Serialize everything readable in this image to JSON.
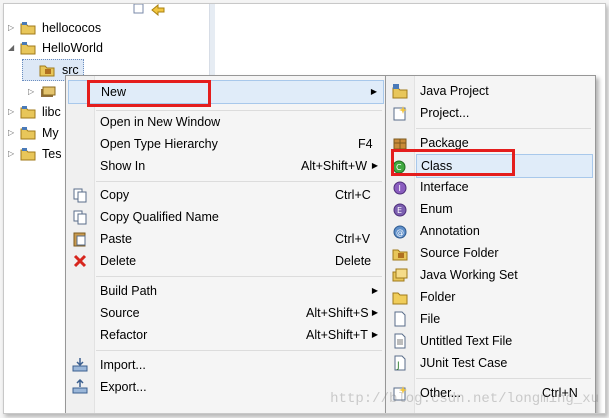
{
  "tree": {
    "items": [
      {
        "label": "hellococos",
        "expanded": false,
        "icon": "project-folder-icon"
      },
      {
        "label": "HelloWorld",
        "expanded": true,
        "icon": "project-folder-icon"
      },
      {
        "label": "src",
        "icon": "source-package-icon"
      },
      {
        "label": "libc",
        "expanded": false,
        "icon": "project-folder-icon"
      },
      {
        "label": "My",
        "expanded": false,
        "icon": "project-folder-icon"
      },
      {
        "label": "Tes",
        "expanded": false,
        "icon": "project-folder-icon"
      }
    ]
  },
  "context_menu": {
    "items": [
      {
        "label": "New",
        "has_submenu": true
      },
      {
        "label": "Open in New Window"
      },
      {
        "label": "Open Type Hierarchy",
        "shortcut": "F4"
      },
      {
        "label": "Show In",
        "shortcut": "Alt+Shift+W",
        "has_submenu": true
      },
      {
        "label": "Copy",
        "shortcut": "Ctrl+C",
        "icon": "copy-icon"
      },
      {
        "label": "Copy Qualified Name",
        "icon": "copy-qualified-icon"
      },
      {
        "label": "Paste",
        "shortcut": "Ctrl+V",
        "icon": "paste-icon"
      },
      {
        "label": "Delete",
        "shortcut": "Delete",
        "icon": "delete-icon"
      },
      {
        "label": "Build Path",
        "has_submenu": true
      },
      {
        "label": "Source",
        "shortcut": "Alt+Shift+S",
        "has_submenu": true
      },
      {
        "label": "Refactor",
        "shortcut": "Alt+Shift+T",
        "has_submenu": true
      },
      {
        "label": "Import...",
        "icon": "import-icon"
      },
      {
        "label": "Export...",
        "icon": "export-icon"
      }
    ]
  },
  "submenu": {
    "items": [
      {
        "label": "Java Project",
        "icon": "java-project-icon"
      },
      {
        "label": "Project...",
        "icon": "project-icon"
      },
      {
        "label": "Package",
        "icon": "package-icon"
      },
      {
        "label": "Class",
        "icon": "class-icon"
      },
      {
        "label": "Interface",
        "icon": "interface-icon"
      },
      {
        "label": "Enum",
        "icon": "enum-icon"
      },
      {
        "label": "Annotation",
        "icon": "annotation-icon"
      },
      {
        "label": "Source Folder",
        "icon": "source-folder-icon"
      },
      {
        "label": "Java Working Set",
        "icon": "working-set-icon"
      },
      {
        "label": "Folder",
        "icon": "folder-icon"
      },
      {
        "label": "File",
        "icon": "file-icon"
      },
      {
        "label": "Untitled Text File",
        "icon": "text-file-icon"
      },
      {
        "label": "JUnit Test Case",
        "icon": "junit-icon"
      },
      {
        "label": "Other...",
        "shortcut": "Ctrl+N",
        "icon": "other-wizard-icon"
      }
    ]
  },
  "watermark": "http://blog.csdn.net/longming_xu",
  "colors": {
    "highlight_box": "#e41d1d",
    "hover_bg": "#e0ecf9"
  }
}
